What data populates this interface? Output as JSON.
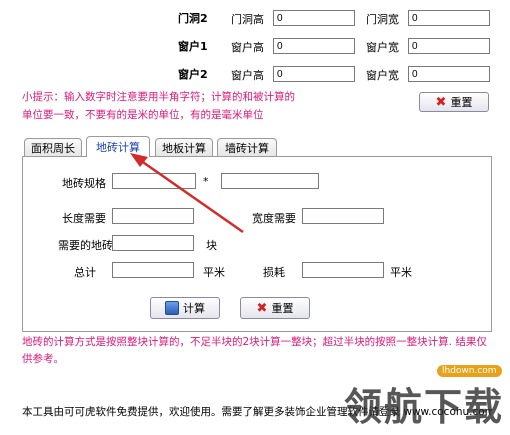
{
  "top_rows": [
    {
      "name": "门洞2",
      "h_label": "门洞高",
      "h_value": "0",
      "w_label": "门洞宽",
      "w_value": "0"
    },
    {
      "name": "窗户1",
      "h_label": "窗户高",
      "h_value": "0",
      "w_label": "窗户宽",
      "w_value": "0"
    },
    {
      "name": "窗户2",
      "h_label": "窗户高",
      "h_value": "0",
      "w_label": "窗户宽",
      "w_value": "0"
    }
  ],
  "hint": {
    "line1": "小提示：输入数字时注意要用半角字符；计算的和被计算的",
    "line2": "单位要一致，不要有的是米的单位，有的是毫米单位"
  },
  "reset_top_label": "重置",
  "tabs": [
    {
      "label": "面积周长",
      "active": false
    },
    {
      "label": "地砖计算",
      "active": true
    },
    {
      "label": "地板计算",
      "active": false
    },
    {
      "label": "墙砖计算",
      "active": false
    }
  ],
  "tile": {
    "spec_label": "地砖规格",
    "spec_sep": "*",
    "spec_a": "",
    "spec_b": "",
    "length_label": "长度需要",
    "length_value": "",
    "width_label": "宽度需要",
    "width_value": "",
    "needed_label": "需要的地砖",
    "needed_value": "",
    "needed_unit": "块",
    "total_label": "总计",
    "total_value": "",
    "total_unit": "平米",
    "loss_label": "损耗",
    "loss_value": "",
    "loss_unit": "平米",
    "calc_label": "计算",
    "reset_label": "重置",
    "note": "地砖的计算方式是按照整块计算的，不足半块的2块计算一整块；超过半块的按照一整块计算. 结果仅供参考。"
  },
  "footer": "本工具由可可虎软件免费提供，欢迎使用。需要了解更多装饰企业管理软件请登录 www.cocohu.com",
  "watermark": {
    "text": "领航下载",
    "badge": "lhdown.com"
  },
  "colors": {
    "hint": "#e0187a",
    "arrow": "#d42a2a",
    "active_tab_text": "#1a3fb0"
  }
}
